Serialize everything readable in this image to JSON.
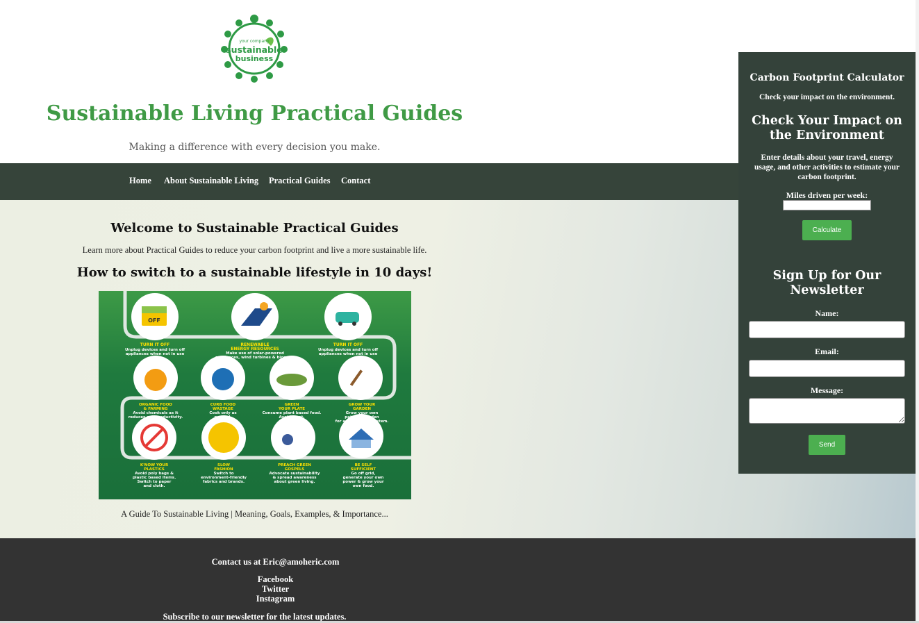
{
  "header": {
    "logo_text_top": "your company",
    "logo_text_main": "sustainable",
    "logo_text_sub": "business",
    "title": "Sustainable Living Practical Guides",
    "tagline": "Making a difference with every decision you make."
  },
  "nav": {
    "items": [
      {
        "label": "Home"
      },
      {
        "label": "About Sustainable Living"
      },
      {
        "label": "Practical Guides"
      },
      {
        "label": "Contact"
      }
    ]
  },
  "main": {
    "welcome_heading": "Welcome to Sustainable Practical Guides",
    "intro": "Learn more about Practical Guides to reduce your carbon footprint and live a more sustainable life.",
    "howto_heading": "How to switch to a sustainable lifestyle in 10 days!",
    "caption": "A Guide To Sustainable Living | Meaning, Goals, Examples, & Importance...",
    "infographic": {
      "steps": [
        {
          "title": "TURN IT OFF",
          "desc1": "Unplug devices and turn off",
          "desc2": "appliances when not in use"
        },
        {
          "title": "RENEWABLE",
          "title2": "ENERGY RESOURCES",
          "desc1": "Make use of solar-powered",
          "desc2": "appliances, wind turbines & biomass"
        },
        {
          "title": "TURN IT OFF",
          "desc1": "Unplug devices and turn off",
          "desc2": "appliances when not in use"
        },
        {
          "title": "ORGANIC FOOD",
          "title2": "& FARMING",
          "desc1": "Avoid chemicals as it",
          "desc2": "reduces soil productivity."
        },
        {
          "title": "CURB FOOD",
          "title2": "WASTAGE",
          "desc1": "Cook only as",
          "desc2": "needed."
        },
        {
          "title": "GREEN",
          "title2": "YOUR PLATE",
          "desc1": "Consume plant based food.",
          "desc2": "Avoid meat."
        },
        {
          "title": "GROW YOUR",
          "title2": "GARDEN",
          "desc1": "Grow your own",
          "desc2": "patch of garden",
          "desc3": "for a healthy ecosystem."
        },
        {
          "title": "K'NOW YOUR",
          "title2": "PLASTICS",
          "desc1": "Avoid poly bags &",
          "desc2": "plastic based items.",
          "desc3": "Switch to paper",
          "desc4": "and cloth."
        },
        {
          "title": "SLOW",
          "title2": "FASHION",
          "desc1": "Switch to",
          "desc2": "environment-friendly",
          "desc3": "fabrics and brands."
        },
        {
          "title": "PREACH GREEN",
          "title2": "GOSPELS",
          "desc1": "Advocate sustainability",
          "desc2": "& spread awareness",
          "desc3": "about green living."
        },
        {
          "title": "BE SELF",
          "title2": "SUFFICIENT",
          "desc1": "Go off grid,",
          "desc2": "generate your own",
          "desc3": "power & grow your",
          "desc4": "own food."
        }
      ],
      "icon_off_label": "OFF"
    }
  },
  "sidebar": {
    "calc_title": "Carbon Footprint Calculator",
    "calc_subtitle": "Check your impact on the environment.",
    "calc_heading": "Check Your Impact on the Environment",
    "calc_desc": "Enter details about your travel, energy usage, and other activities to estimate your carbon footprint.",
    "miles_label": "Miles driven per week:",
    "miles_value": "",
    "calc_button": "Calculate",
    "newsletter_heading": "Sign Up for Our Newsletter",
    "name_label": "Name:",
    "name_value": "",
    "email_label": "Email:",
    "email_value": "",
    "message_label": "Message:",
    "message_value": "",
    "send_button": "Send"
  },
  "footer": {
    "contact": "Contact us at Eric@amoheric.com",
    "facebook": "Facebook",
    "twitter": "Twitter",
    "instagram": "Instagram",
    "subscribe": "Subscribe to our newsletter for the latest updates."
  },
  "colors": {
    "brand_green": "#3f9a45",
    "nav_bg": "#36443a",
    "sidebar_bg": "#34423a",
    "button_green": "#4caf50",
    "footer_bg": "#333333"
  }
}
